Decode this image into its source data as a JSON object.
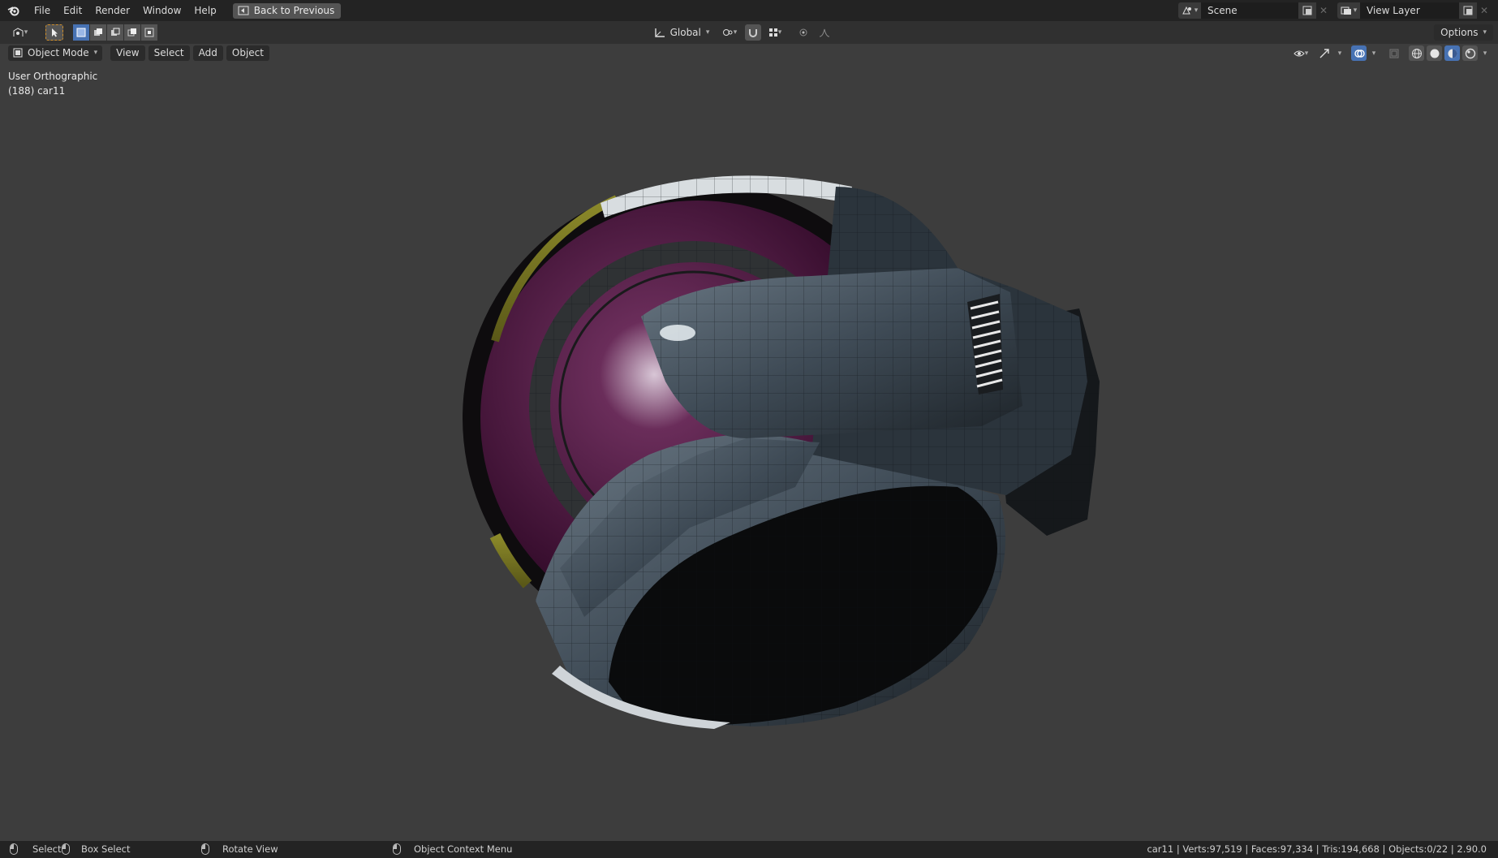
{
  "topbar": {
    "menus": [
      "File",
      "Edit",
      "Render",
      "Window",
      "Help"
    ],
    "back_button": "Back to Previous",
    "scene_name": "Scene",
    "view_layer_name": "View Layer"
  },
  "toolbar": {
    "transform_orientation": "Global",
    "options_label": "Options"
  },
  "header": {
    "mode": "Object Mode",
    "menus": [
      "View",
      "Select",
      "Add",
      "Object"
    ]
  },
  "viewport": {
    "view_name": "User Orthographic",
    "object_label": "(188) car11"
  },
  "statusbar": {
    "select": "Select",
    "box_select": "Box Select",
    "rotate_view": "Rotate View",
    "context_menu": "Object Context Menu",
    "stats": "car11 | Verts:97,519 | Faces:97,334 | Tris:194,668 | Objects:0/22 | 2.90.0"
  },
  "colors": {
    "accent": "#4772b3",
    "viewport_bg": "#3d3d3d",
    "header_bg": "#232323",
    "toolbar_bg": "#303030"
  }
}
